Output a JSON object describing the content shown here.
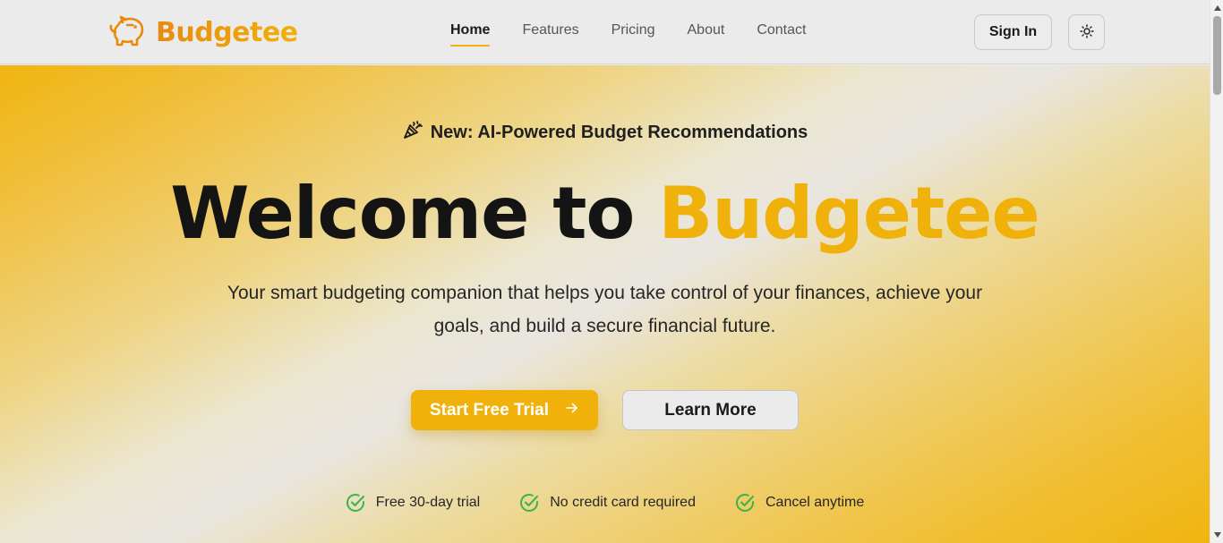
{
  "header": {
    "logo_text": "Budgetee",
    "logo_icon": "piggy-bank-icon",
    "nav": [
      {
        "label": "Home",
        "active": true
      },
      {
        "label": "Features",
        "active": false
      },
      {
        "label": "Pricing",
        "active": false
      },
      {
        "label": "About",
        "active": false
      },
      {
        "label": "Contact",
        "active": false
      }
    ],
    "sign_in_label": "Sign In",
    "theme_toggle_icon": "sun-icon"
  },
  "hero": {
    "badge_icon": "party-popper-icon",
    "badge_prefix": "New:",
    "badge_text": " AI-Powered Budget Recommendations",
    "headline_part1": "Welcome to ",
    "headline_part2": "Budgetee",
    "subtitle_line1": "Your smart budgeting companion that helps you take control of your finances, achieve your",
    "subtitle_line2": "goals, and build a secure financial future.",
    "primary_cta_label": "Start Free Trial",
    "primary_cta_icon": "arrow-right-icon",
    "secondary_cta_label": "Learn More",
    "features": [
      {
        "icon": "check-circle-icon",
        "label": "Free 30-day trial"
      },
      {
        "icon": "check-circle-icon",
        "label": "No credit card required"
      },
      {
        "icon": "check-circle-icon",
        "label": "Cancel anytime"
      }
    ]
  },
  "colors": {
    "brand": "#f0b10a",
    "brand_dark": "#e88a0f",
    "check": "#3cb34a",
    "header_bg": "#ebebeb"
  }
}
